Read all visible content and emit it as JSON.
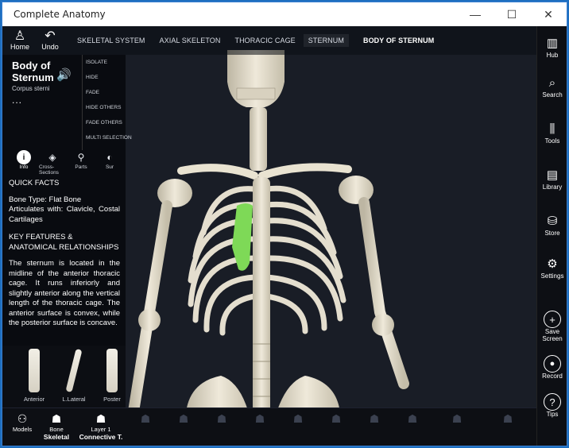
{
  "window": {
    "title": "Complete Anatomy",
    "controls": [
      "—",
      "☐",
      "✕"
    ]
  },
  "nav": {
    "home": "Home",
    "undo": "Undo"
  },
  "breadcrumbs": [
    "SKELETAL SYSTEM",
    "AXIAL SKELETON",
    "THORACIC CAGE",
    "STERNUM",
    "BODY OF STERNUM"
  ],
  "structure": {
    "name": "Body of Sternum",
    "latin": "Corpus sterni",
    "more": "..."
  },
  "actions": [
    "ISOLATE",
    "HIDE",
    "FADE",
    "HIDE OTHERS",
    "FADE OTHERS",
    "MULTI SELECTION"
  ],
  "tabs": [
    {
      "label": "Info",
      "icon": "info-icon",
      "glyph": "i"
    },
    {
      "label": "Cross-Sections",
      "icon": "layers-icon",
      "glyph": "◈"
    },
    {
      "label": "Parts",
      "icon": "bone-icon",
      "glyph": "⚲"
    },
    {
      "label": "Sur",
      "icon": "surface-icon",
      "glyph": "◐"
    }
  ],
  "info": {
    "quick_facts_heading": "QUICK FACTS",
    "bone_type": "Bone Type: Flat Bone",
    "articulates": "Articulates with: Clavicle, Costal Cartilages",
    "features_heading": "KEY FEATURES & ANATOMICAL RELATIONSHIPS",
    "paragraph": "The sternum is located in the midline of the anterior thoracic cage. It runs inferiorly and slightly anterior along the vertical length of the thoracic cage. The anterior surface is convex, while the posterior surface is concave."
  },
  "thumbnails": [
    "Anterior",
    "L.Lateral",
    "Poster"
  ],
  "right_toolbar": [
    {
      "label": "Hub",
      "icon": "hub-icon",
      "glyph": "▥"
    },
    {
      "label": "Search",
      "icon": "search-icon",
      "glyph": "⌕"
    },
    {
      "label": "Tools",
      "icon": "tools-icon",
      "glyph": "⫼"
    },
    {
      "label": "Library",
      "icon": "library-icon",
      "glyph": "▤"
    },
    {
      "label": "Store",
      "icon": "store-icon",
      "glyph": "⛁"
    },
    {
      "label": "Settings",
      "icon": "gear-icon",
      "glyph": "⚙"
    },
    {
      "label": "Save Screen",
      "icon": "plus-icon",
      "glyph": "+"
    },
    {
      "label": "Record",
      "icon": "record-icon",
      "glyph": "●"
    },
    {
      "label": "Tips",
      "icon": "help-icon",
      "glyph": "?"
    }
  ],
  "bottom": {
    "models": "Models",
    "bone_label": "Bone",
    "bone_sub": "Skeletal",
    "layer_label": "Layer 1",
    "layer_sub": "Connective T."
  },
  "colors": {
    "highlight": "#7ed957",
    "bone": "#e9e3d1",
    "panel": "#080a0e"
  }
}
